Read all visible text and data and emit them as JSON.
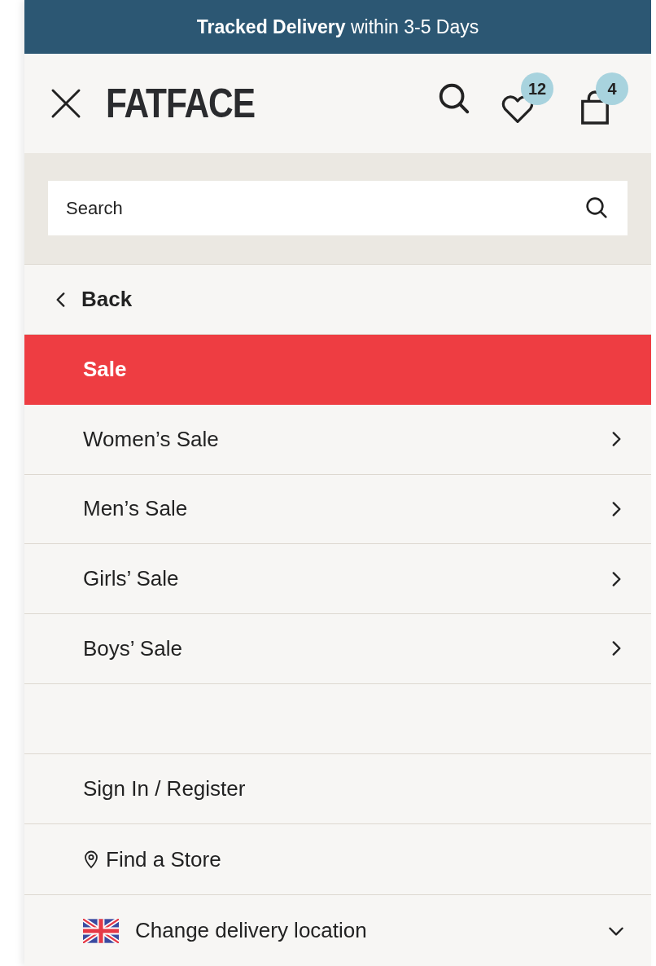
{
  "banner": {
    "text": "**Tracked Delivery** within 3-5 Days"
  },
  "header": {
    "logo": "FATFACE",
    "wishlist_count": "12",
    "bag_count": "4"
  },
  "search": {
    "placeholder": "Search"
  },
  "menu": [
    {
      "kind": "back",
      "label": "Back"
    },
    {
      "kind": "heading",
      "label": "Sale"
    },
    {
      "kind": "category",
      "label": "Women’s Sale"
    },
    {
      "kind": "category",
      "label": "Men’s Sale"
    },
    {
      "kind": "category",
      "label": "Girls’ Sale"
    },
    {
      "kind": "category",
      "label": "Boys’ Sale"
    },
    {
      "kind": "spacer"
    }
  ],
  "footer_links": [
    {
      "kind": "plain",
      "label": "Sign In / Register"
    },
    {
      "kind": "store",
      "label": "Find a Store"
    },
    {
      "kind": "location",
      "label": "Change delivery location"
    }
  ]
}
